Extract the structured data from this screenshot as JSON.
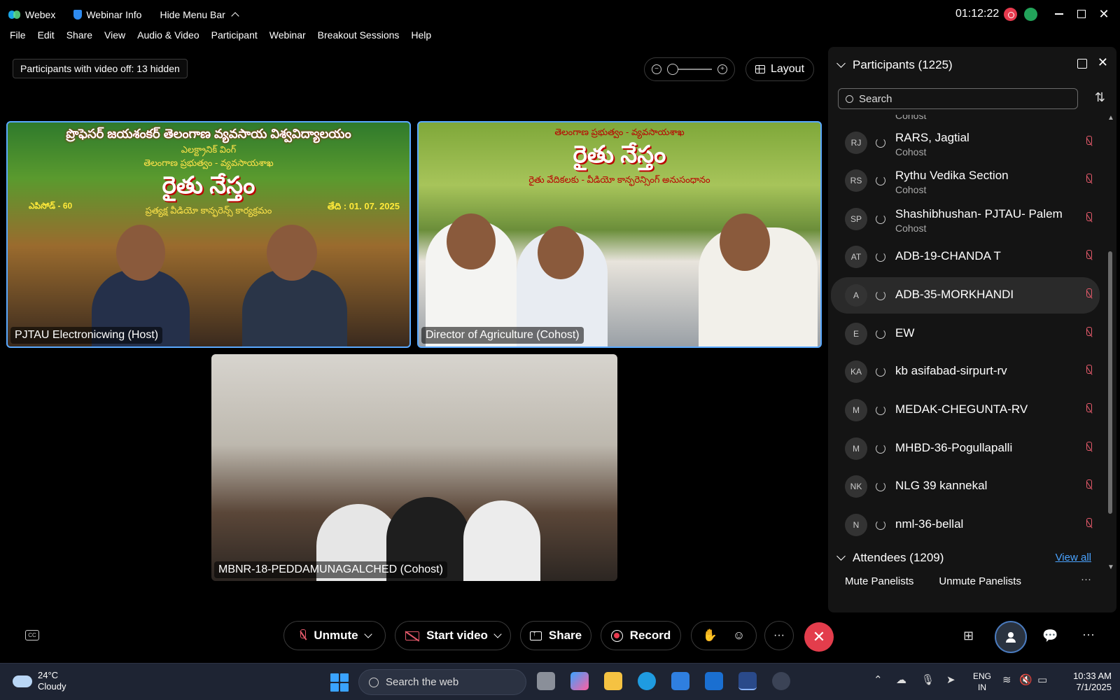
{
  "titlebar": {
    "app_name": "Webex",
    "webinar_info": "Webinar Info",
    "hide_menu_bar": "Hide Menu Bar",
    "timer": "01:12:22",
    "minimize": "—",
    "close": "✕"
  },
  "menu": [
    "File",
    "Edit",
    "Share",
    "View",
    "Audio & Video",
    "Participant",
    "Webinar",
    "Breakout Sessions",
    "Help"
  ],
  "hidden_info": "Participants with video off: 13 hidden",
  "layout_label": "Layout",
  "zoom": {
    "out": "−",
    "in": "+"
  },
  "videos": [
    {
      "label": "PJTAU Electronicwing (Host)",
      "banner_top": "ప్రొఫెసర్ జయశంకర్ తెలంగాణ వ్యవసాయ విశ్వవిద్యాలయం",
      "banner_sub": "ఎలక్ట్రానిక్ వింగ్",
      "banner_mid": "తెలంగాణ ప్రభుత్వం - వ్యవసాయశాఖ",
      "banner_big": "రైతు నేస్తం",
      "banner_small": "ప్రత్యక్ష వీడియో కాన్ఫరెన్స్ కార్యక్రమం",
      "episode": "ఎపిసోడ్ - 60",
      "date": "తేది : 01. 07. 2025"
    },
    {
      "label": "Director of Agriculture (Cohost)",
      "banner_mid": "తెలంగాణ ప్రభుత్వం - వ్యవసాయశాఖ",
      "banner_big": "రైతు నేస్తం",
      "banner_small": "రైతు వేదికలకు - వీడియో కాన్ఫరెన్సింగ్ అనుసంధానం"
    },
    {
      "label": "MBNR-18-PEDDAMUNAGALCHED (Cohost)"
    }
  ],
  "participants": {
    "title": "Participants (1225)",
    "close": "✕",
    "search_placeholder": "Search",
    "sort": "⇅",
    "partial_role": "Cohost",
    "list": [
      {
        "initials": "RJ",
        "name": "RARS, Jagtial",
        "role": "Cohost"
      },
      {
        "initials": "RS",
        "name": "Rythu Vedika Section",
        "role": "Cohost"
      },
      {
        "initials": "SP",
        "name": "Shashibhushan- PJTAU- Palem",
        "role": "Cohost"
      },
      {
        "initials": "AT",
        "name": "ADB-19-CHANDA T",
        "role": ""
      },
      {
        "initials": "A",
        "name": "ADB-35-MORKHANDI",
        "role": ""
      },
      {
        "initials": "E",
        "name": "EW",
        "role": ""
      },
      {
        "initials": "KA",
        "name": "kb asifabad-sirpurt-rv",
        "role": ""
      },
      {
        "initials": "M",
        "name": "MEDAK-CHEGUNTA-RV",
        "role": ""
      },
      {
        "initials": "M",
        "name": "MHBD-36-Pogullapalli",
        "role": ""
      },
      {
        "initials": "NK",
        "name": "NLG 39 kannekal",
        "role": ""
      },
      {
        "initials": "N",
        "name": "nml-36-bellal",
        "role": ""
      }
    ],
    "attendees_title": "Attendees (1209)",
    "view_all": "View all",
    "mute_panelists": "Mute Panelists",
    "unmute_panelists": "Unmute Panelists",
    "more": "···"
  },
  "controls": {
    "unmute": "Unmute",
    "start_video": "Start video",
    "share": "Share",
    "record": "Record",
    "raise_hand": "✋",
    "reactions": "☺",
    "more": "···",
    "end": "✕",
    "apps": "⊞",
    "chat": "💬",
    "overflow": "···"
  },
  "taskbar": {
    "temp": "24°C",
    "weather": "Cloudy",
    "search_placeholder": "Search the web",
    "lang1": "ENG",
    "lang2": "IN",
    "time": "10:33 AM",
    "date": "7/1/2025"
  },
  "colors": {
    "accent": "#5aa9ff",
    "end_call": "#e33d4c",
    "muted": "#e55a6b",
    "link": "#4aa3ff"
  }
}
